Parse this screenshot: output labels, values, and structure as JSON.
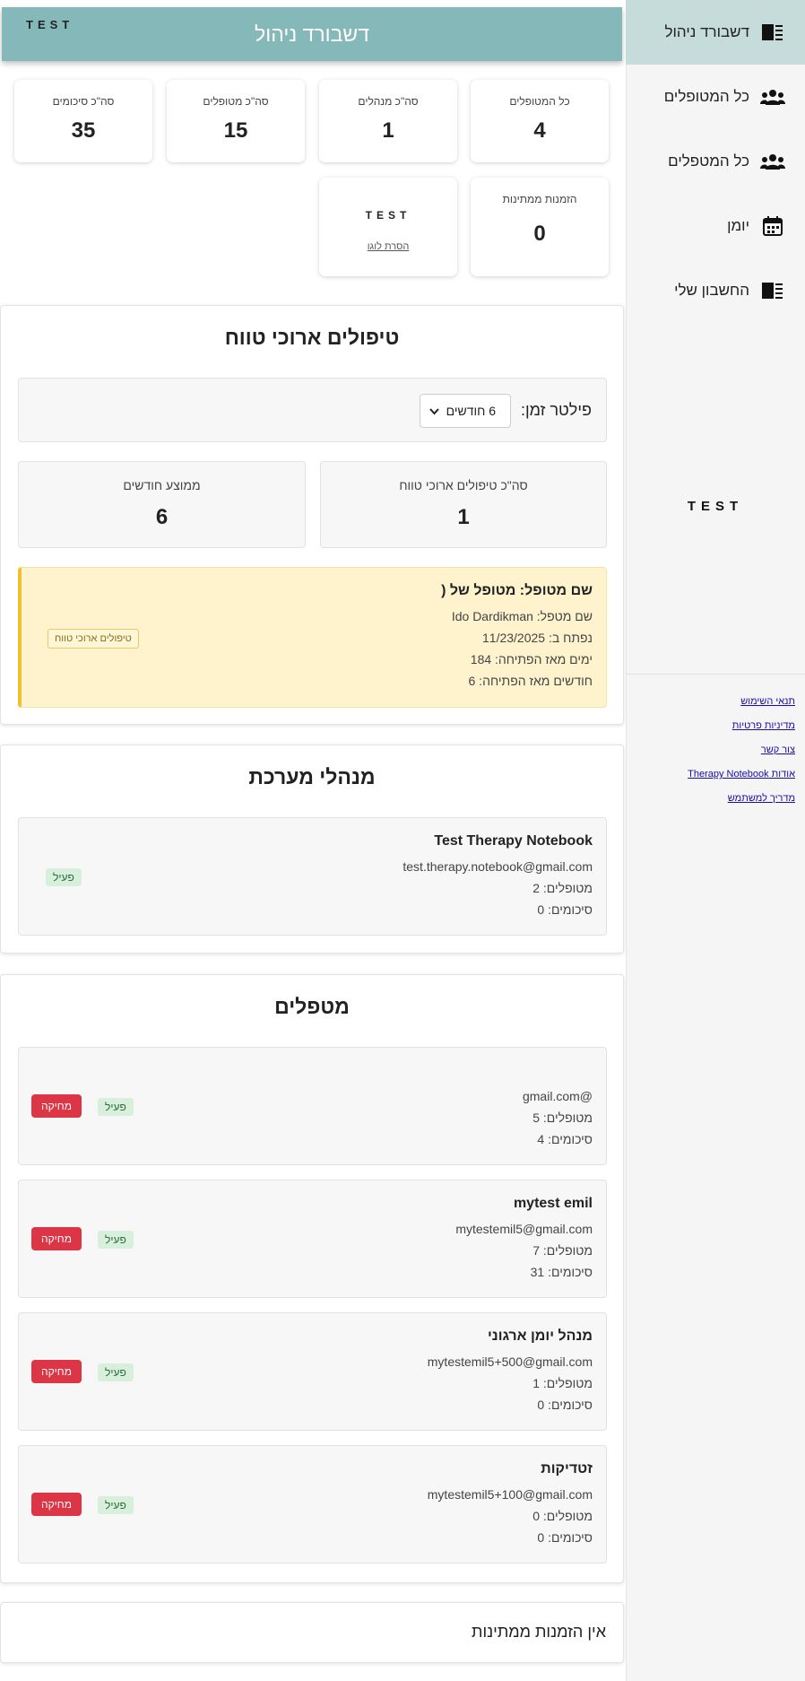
{
  "app": {
    "logo_text": "TEST",
    "title": "דשבורד ניהול"
  },
  "sidebar": {
    "items": [
      {
        "label": "דשבורד ניהול",
        "icon": "book-icon"
      },
      {
        "label": "כל המטופלים",
        "icon": "users-icon"
      },
      {
        "label": "כל המטפלים",
        "icon": "users-icon"
      },
      {
        "label": "יומן",
        "icon": "calendar-icon"
      },
      {
        "label": "החשבון שלי",
        "icon": "book-icon"
      }
    ],
    "logo_text": "TEST",
    "links": [
      "תנאי השימוש",
      "מדיניות פרטיות",
      "צור קשר",
      "אודות Therapy Notebook",
      "מדריך למשתמש"
    ]
  },
  "stats": {
    "patients": {
      "label": "כל המטופלים",
      "value": "4"
    },
    "managers": {
      "label": "סה\"כ מנהלים",
      "value": "1"
    },
    "therapists": {
      "label": "סה\"כ מטופלים",
      "value": "15"
    },
    "summaries": {
      "label": "סה\"כ סיכומים",
      "value": "35"
    },
    "pending": {
      "label": "הזמנות ממתינות",
      "value": "0"
    },
    "logo": {
      "text": "TEST",
      "remove_label": "הסרת לוגו"
    }
  },
  "long_term": {
    "title": "טיפולים ארוכי טווח",
    "filter_label": "פילטר זמן:",
    "filter_value": "6 חודשים",
    "total_label": "סה\"כ טיפולים ארוכי טווח",
    "total_value": "1",
    "avg_label": "ממוצע חודשים",
    "avg_value": "6",
    "item": {
      "name": "שם מטופל: מטופל של ‎(",
      "therapist": "שם מטפל: Ido Dardikman",
      "opened": "נפתח ב: 11/23/2025",
      "days": "ימים מאז הפתיחה: 184",
      "months": "חודשים מאז הפתיחה: 6",
      "tag": "טיפולים ארוכי טווח"
    }
  },
  "admins": {
    "title": "מנהלי מערכת",
    "items": [
      {
        "name": "Test Therapy Notebook",
        "email": "test.therapy.notebook@gmail.com",
        "patients": "מטופלים: 2",
        "summaries": "סיכומים: 0",
        "status": "פעיל"
      }
    ]
  },
  "therapists": {
    "title": "מטפלים",
    "delete_label": "מחיקה",
    "items": [
      {
        "name": "",
        "email": "@gmail.com",
        "patients": "מטופלים: 5",
        "summaries": "סיכומים: 4",
        "status": "פעיל"
      },
      {
        "name": "mytest emil",
        "email": "mytestemil5@gmail.com",
        "patients": "מטופלים: 7",
        "summaries": "סיכומים: 31",
        "status": "פעיל"
      },
      {
        "name": "מנהל יומן ארגוני",
        "email": "mytestemil5+500@gmail.com",
        "patients": "מטופלים: 1",
        "summaries": "סיכומים: 0",
        "status": "פעיל"
      },
      {
        "name": "זטדיקות",
        "email": "mytestemil5+100@gmail.com",
        "patients": "מטופלים: 0",
        "summaries": "סיכומים: 0",
        "status": "פעיל"
      }
    ]
  },
  "invites": {
    "empty_text": "אין הזמנות ממתינות"
  }
}
